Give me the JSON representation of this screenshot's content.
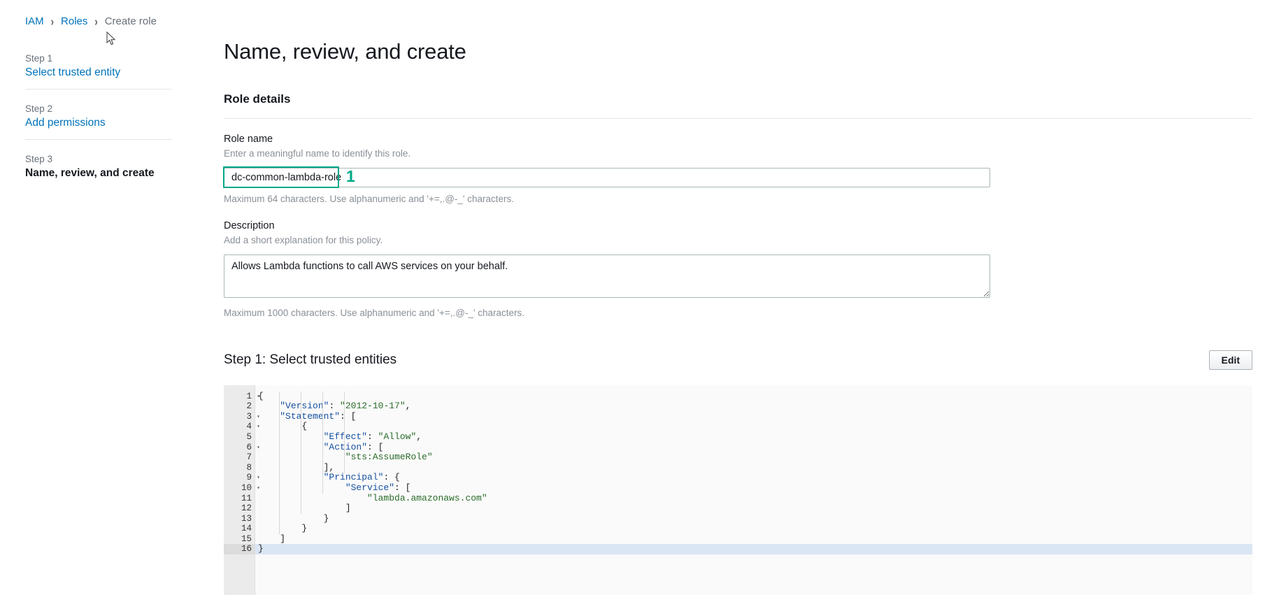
{
  "breadcrumb": {
    "items": [
      {
        "label": "IAM",
        "type": "link"
      },
      {
        "label": "Roles",
        "type": "link"
      },
      {
        "label": "Create role",
        "type": "current"
      }
    ],
    "separator": "›"
  },
  "sidebar": {
    "steps": [
      {
        "number_label": "Step 1",
        "name": "Select trusted entity",
        "current": false
      },
      {
        "number_label": "Step 2",
        "name": "Add permissions",
        "current": false
      },
      {
        "number_label": "Step 3",
        "name": "Name, review, and create",
        "current": true
      }
    ]
  },
  "main": {
    "page_title": "Name, review, and create",
    "role_details_heading": "Role details",
    "role_name": {
      "label": "Role name",
      "description": "Enter a meaningful name to identify this role.",
      "value": "dc-common-lambda-role",
      "placeholder": "",
      "hint": "Maximum 64 characters. Use alphanumeric and '+=,.@-_' characters."
    },
    "description": {
      "label": "Description",
      "description": "Add a short explanation for this policy.",
      "value": "Allows Lambda functions to call AWS services on your behalf.",
      "placeholder": "",
      "hint": "Maximum 1000 characters. Use alphanumeric and '+=,.@-_' characters."
    },
    "step1_section": {
      "title": "Step 1: Select trusted entities",
      "edit_button": "Edit"
    }
  },
  "annotation": {
    "marker_number": "1",
    "color": "#00a887"
  },
  "colors": {
    "link": "#0073bb",
    "muted": "#687078",
    "text": "#16191f",
    "annotation_green": "#00a887",
    "editor_bg": "#fafafa",
    "gutter_bg": "#ebebeb",
    "active_line": "#dbe6f4"
  },
  "policy_editor": {
    "active_line_number": 16,
    "lines": [
      {
        "n": "1",
        "fold": true,
        "indent": 0,
        "segments": [
          {
            "t": "punct",
            "v": "{"
          }
        ]
      },
      {
        "n": "2",
        "fold": false,
        "indent": 1,
        "segments": [
          {
            "t": "key",
            "v": "\"Version\""
          },
          {
            "t": "punct",
            "v": ": "
          },
          {
            "t": "str",
            "v": "\"2012-10-17\""
          },
          {
            "t": "punct",
            "v": ","
          }
        ]
      },
      {
        "n": "3",
        "fold": true,
        "indent": 1,
        "segments": [
          {
            "t": "key",
            "v": "\"Statement\""
          },
          {
            "t": "punct",
            "v": ": ["
          }
        ]
      },
      {
        "n": "4",
        "fold": true,
        "indent": 2,
        "segments": [
          {
            "t": "punct",
            "v": "{"
          }
        ]
      },
      {
        "n": "5",
        "fold": false,
        "indent": 3,
        "segments": [
          {
            "t": "key",
            "v": "\"Effect\""
          },
          {
            "t": "punct",
            "v": ": "
          },
          {
            "t": "str",
            "v": "\"Allow\""
          },
          {
            "t": "punct",
            "v": ","
          }
        ]
      },
      {
        "n": "6",
        "fold": true,
        "indent": 3,
        "segments": [
          {
            "t": "key",
            "v": "\"Action\""
          },
          {
            "t": "punct",
            "v": ": ["
          }
        ]
      },
      {
        "n": "7",
        "fold": false,
        "indent": 4,
        "segments": [
          {
            "t": "str",
            "v": "\"sts:AssumeRole\""
          }
        ]
      },
      {
        "n": "8",
        "fold": false,
        "indent": 3,
        "segments": [
          {
            "t": "punct",
            "v": "],"
          }
        ]
      },
      {
        "n": "9",
        "fold": true,
        "indent": 3,
        "segments": [
          {
            "t": "key",
            "v": "\"Principal\""
          },
          {
            "t": "punct",
            "v": ": {"
          }
        ]
      },
      {
        "n": "10",
        "fold": true,
        "indent": 4,
        "segments": [
          {
            "t": "key",
            "v": "\"Service\""
          },
          {
            "t": "punct",
            "v": ": ["
          }
        ]
      },
      {
        "n": "11",
        "fold": false,
        "indent": 5,
        "segments": [
          {
            "t": "str",
            "v": "\"lambda.amazonaws.com\""
          }
        ]
      },
      {
        "n": "12",
        "fold": false,
        "indent": 4,
        "segments": [
          {
            "t": "punct",
            "v": "]"
          }
        ]
      },
      {
        "n": "13",
        "fold": false,
        "indent": 3,
        "segments": [
          {
            "t": "punct",
            "v": "}"
          }
        ]
      },
      {
        "n": "14",
        "fold": false,
        "indent": 2,
        "segments": [
          {
            "t": "punct",
            "v": "}"
          }
        ]
      },
      {
        "n": "15",
        "fold": false,
        "indent": 1,
        "segments": [
          {
            "t": "punct",
            "v": "]"
          }
        ]
      },
      {
        "n": "16",
        "fold": false,
        "indent": 0,
        "segments": [
          {
            "t": "punct",
            "v": "}"
          }
        ]
      }
    ]
  }
}
